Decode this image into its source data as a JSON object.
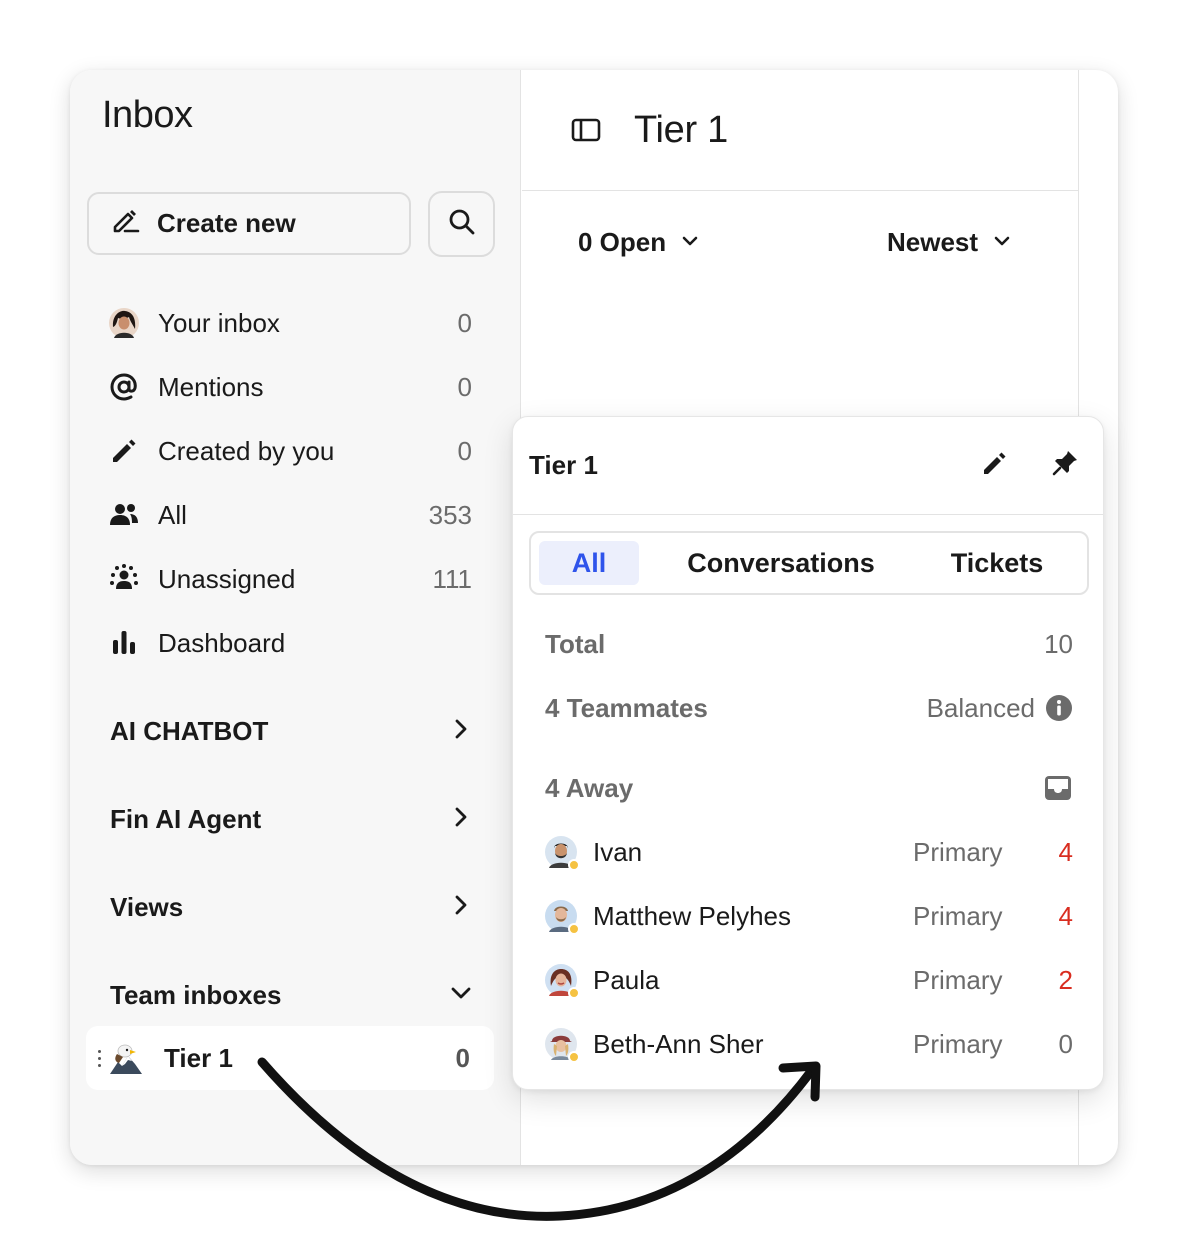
{
  "sidebar": {
    "title": "Inbox",
    "create_new": "Create new",
    "items": [
      {
        "label": "Your inbox",
        "count": "0",
        "icon": "avatar-icon"
      },
      {
        "label": "Mentions",
        "count": "0",
        "icon": "at-sign-icon"
      },
      {
        "label": "Created by you",
        "count": "0",
        "icon": "pencil-icon"
      },
      {
        "label": "All",
        "count": "353",
        "icon": "people-icon"
      },
      {
        "label": "Unassigned",
        "count": "111",
        "icon": "unassigned-icon"
      },
      {
        "label": "Dashboard",
        "count": "",
        "icon": "bar-chart-icon"
      }
    ],
    "sections": [
      {
        "label": "AI CHATBOT",
        "chevron": "right"
      },
      {
        "label": "Fin AI Agent",
        "chevron": "right"
      },
      {
        "label": "Views",
        "chevron": "right"
      },
      {
        "label": "Team inboxes",
        "chevron": "down"
      }
    ],
    "team_inbox": {
      "label": "Tier 1",
      "count": "0",
      "icon": "eagle-icon"
    }
  },
  "main": {
    "title": "Tier 1",
    "filter_status": "0 Open",
    "filter_sort": "Newest"
  },
  "popover": {
    "title": "Tier 1",
    "tabs": [
      "All",
      "Conversations",
      "Tickets"
    ],
    "active_tab": "All",
    "total_label": "Total",
    "total_value": "10",
    "teammates_label": "4 Teammates",
    "teammates_mode": "Balanced",
    "away_label": "4 Away",
    "members": [
      {
        "name": "Ivan",
        "role": "Primary",
        "count": "4"
      },
      {
        "name": "Matthew Pelyhes",
        "role": "Primary",
        "count": "4"
      },
      {
        "name": "Paula",
        "role": "Primary",
        "count": "2"
      },
      {
        "name": "Beth-Ann Sher",
        "role": "Primary",
        "count": "0"
      }
    ]
  },
  "colors": {
    "accent": "#2f54eb",
    "alert": "#d92d20",
    "away_dot": "#f5c242",
    "sidebar_bg": "#f7f7f7"
  }
}
